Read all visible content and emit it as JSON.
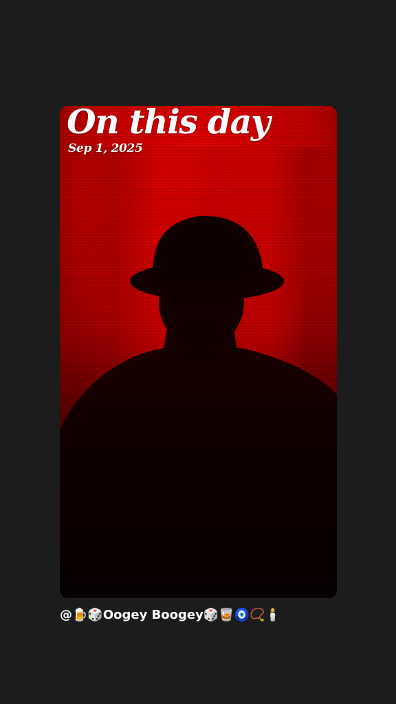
{
  "memory": {
    "title": "On this day",
    "date": "Sep 1, 2025",
    "photo_subject": "silhouette of a person wearing a bowler hat against a red background"
  },
  "creator": {
    "handle": "@🍺🎲Oogey Boogey🎲🥃🧿📿🕯️"
  },
  "colors": {
    "page_background": "#1c1c1c",
    "photo_red": "#d40000",
    "silhouette": "#120000",
    "text": "#ffffff"
  }
}
